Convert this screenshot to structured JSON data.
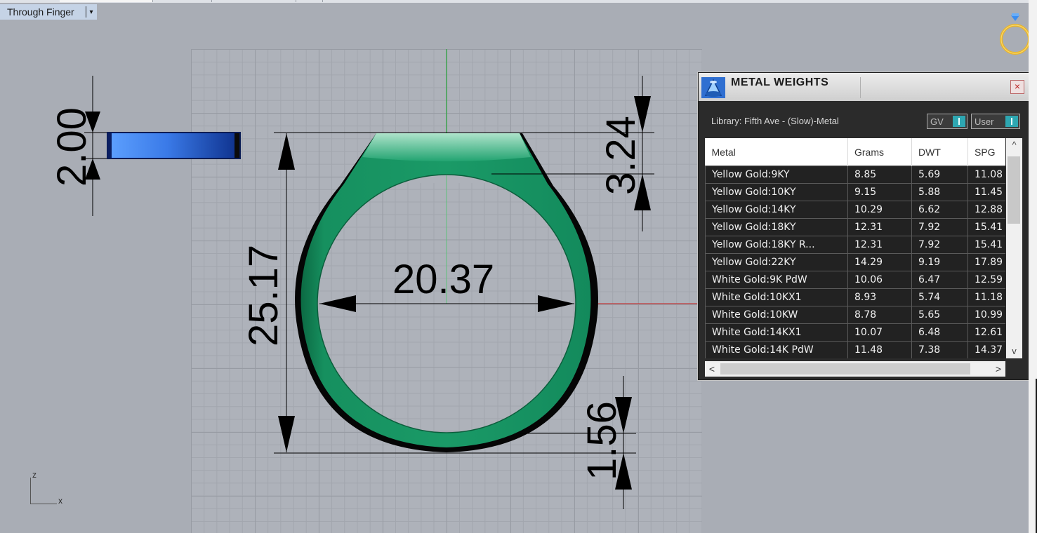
{
  "viewport": {
    "title": "Through Finger",
    "dropdown_arrow": "▾"
  },
  "dimensions": {
    "band_thickness": "2.00",
    "top_height": "3.24",
    "overall_height": "25.17",
    "inner_diameter": "20.37",
    "bottom_thickness": "1.56"
  },
  "axes": {
    "z": "z",
    "x": "x"
  },
  "panel": {
    "title": "METAL WEIGHTS",
    "close": "×",
    "library": "Library: Fifth Ave - (Slow)-Metal",
    "toggle_gv": "GV",
    "toggle_user": "User",
    "columns": [
      "Metal",
      "Grams",
      "DWT",
      "SPG"
    ],
    "rows": [
      [
        "Yellow Gold:9KY",
        "8.85",
        "5.69",
        "11.08"
      ],
      [
        "Yellow Gold:10KY",
        "9.15",
        "5.88",
        "11.45"
      ],
      [
        "Yellow Gold:14KY",
        "10.29",
        "6.62",
        "12.88"
      ],
      [
        "Yellow Gold:18KY",
        "12.31",
        "7.92",
        "15.41"
      ],
      [
        "Yellow Gold:18KY R...",
        "12.31",
        "7.92",
        "15.41"
      ],
      [
        "Yellow Gold:22KY",
        "14.29",
        "9.19",
        "17.89"
      ],
      [
        "White Gold:9K PdW",
        "10.06",
        "6.47",
        "12.59"
      ],
      [
        "White Gold:10KX1",
        "8.93",
        "5.74",
        "11.18"
      ],
      [
        "White Gold:10KW",
        "8.78",
        "5.65",
        "10.99"
      ],
      [
        "White Gold:14KX1",
        "10.07",
        "6.48",
        "12.61"
      ],
      [
        "White Gold:14K PdW",
        "11.48",
        "7.38",
        "14.37"
      ]
    ],
    "scroll_up": "^",
    "scroll_down": "v",
    "scroll_left": "<",
    "scroll_right": ">"
  },
  "colors": {
    "ring_green": "#138a5c",
    "viewport_bg": "#a9adb5",
    "band_blue": "#3a7ae8",
    "accent_teal": "#2ea7b2"
  },
  "icons": [
    "ring-gumball-icon",
    "metal-weights-logo-icon",
    "close-icon"
  ]
}
